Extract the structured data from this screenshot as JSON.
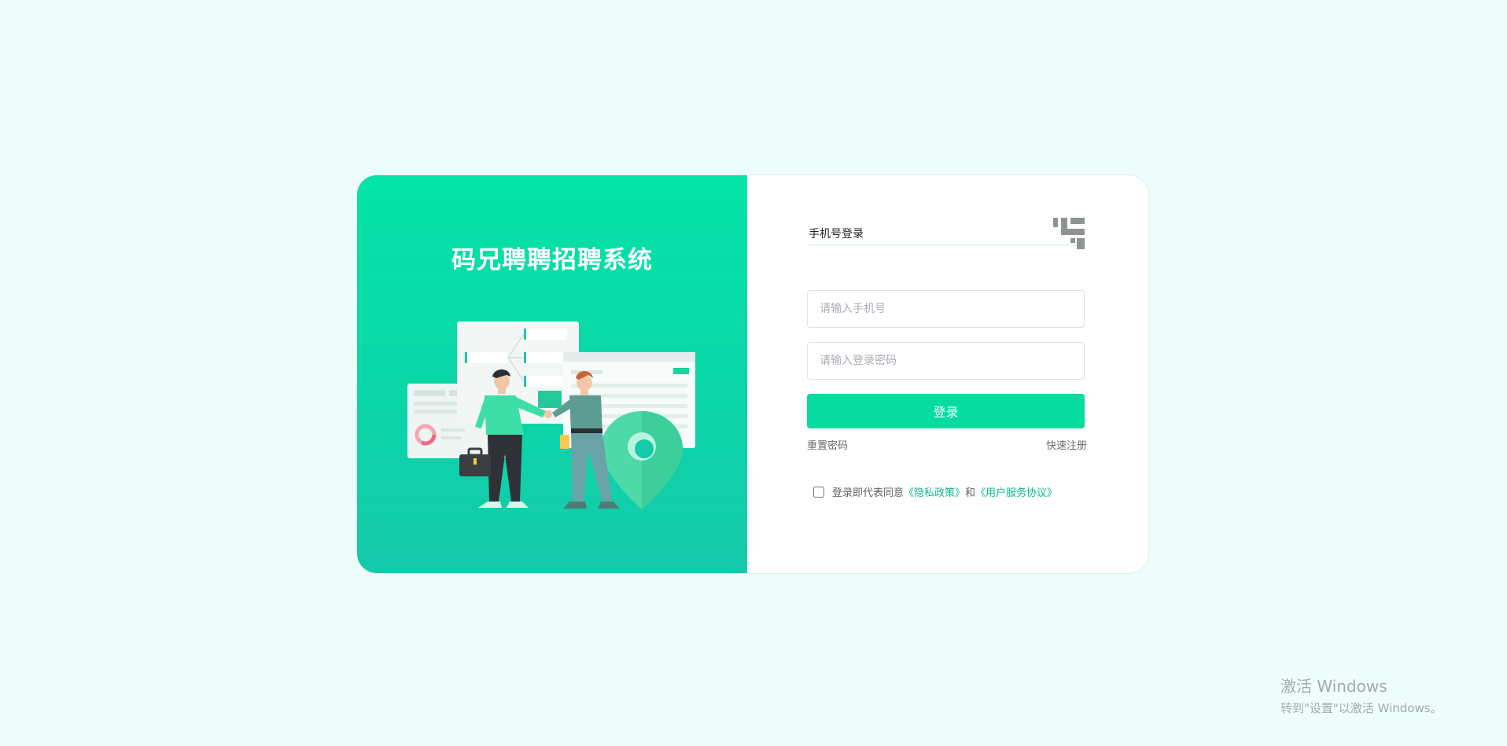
{
  "brand": {
    "title": "码兄聘聘招聘系统",
    "accent_color": "#06dba0",
    "gradient_top": "#04e4a8",
    "gradient_bottom": "#16c9ab"
  },
  "login": {
    "tab_label": "手机号登录",
    "qr_icon": "qr-code-corner-icon",
    "phone_placeholder": "请输入手机号",
    "password_placeholder": "请输入登录密码",
    "submit_label": "登录",
    "reset_label": "重置密码",
    "register_label": "快速注册"
  },
  "agreement": {
    "prefix": "登录即代表同意",
    "privacy_link": "《隐私政策》",
    "conjunction": "和",
    "service_link": "《用户服务协议》",
    "checked": false
  },
  "watermark": {
    "line1": "激活 Windows",
    "line2": "转到\"设置\"以激活 Windows。"
  }
}
